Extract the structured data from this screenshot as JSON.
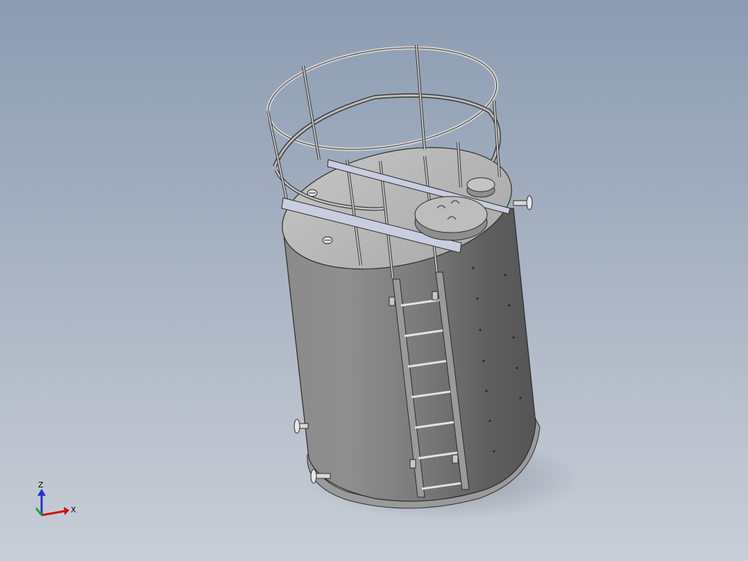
{
  "viewport": {
    "background_top": "#8c9cb2",
    "background_bottom": "#c9ced6"
  },
  "model": {
    "description_icon": "vertical-storage-tank-icon",
    "shell_color": "#8f8f8f",
    "top_color": "#b9b9b9",
    "rail_color": "#d4d4d4",
    "edge_color": "#2a2a2a"
  },
  "triad": {
    "z_label": "Z",
    "x_label": "X",
    "z_color": "#2233cc",
    "x_color": "#cc1111",
    "y_color": "#11aa22"
  }
}
